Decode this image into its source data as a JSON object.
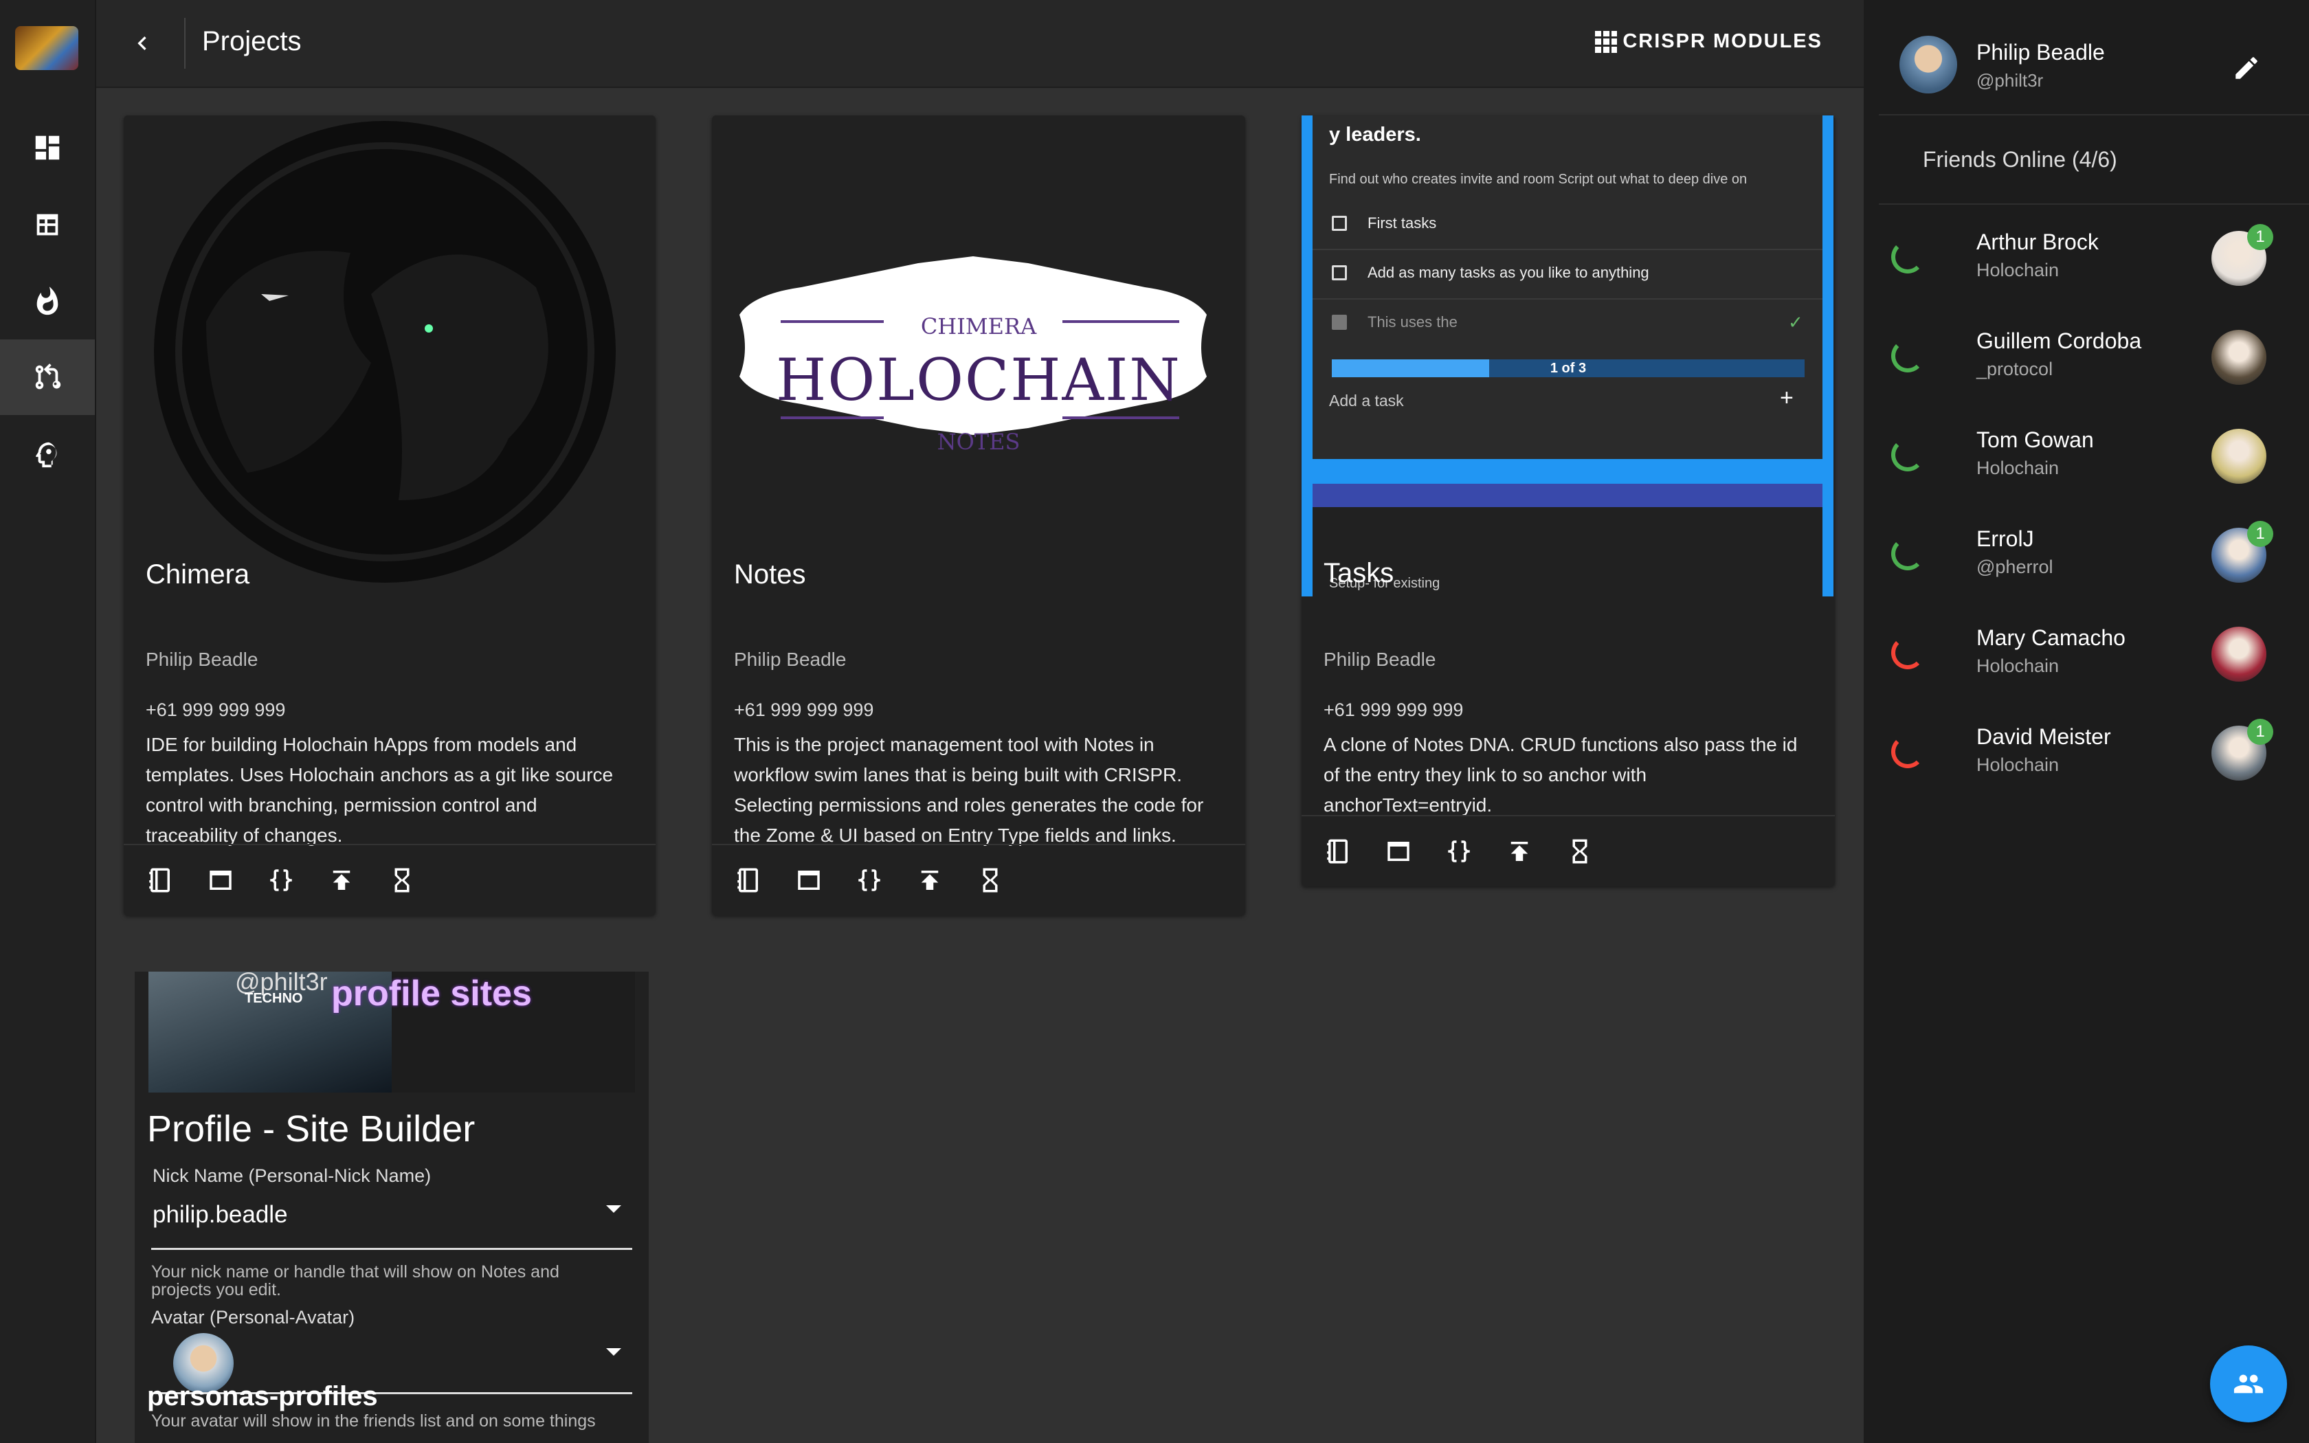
{
  "topbar": {
    "title": "Projects",
    "crispr_label": "CRISPR MODULES"
  },
  "cards": [
    {
      "title": "Chimera",
      "author": "Philip Beadle",
      "phone": "+61 999 999 999",
      "description": "IDE for building Holochain hApps from models and templates. Uses Holochain anchors as a git like source control with branching, permission control and traceability of changes."
    },
    {
      "title": "Notes",
      "author": "Philip Beadle",
      "phone": "+61 999 999 999",
      "description": "This is the project management tool with Notes in workflow swim lanes that is being built with CRISPR. Selecting permissions and roles generates the code for the Zome & UI based on Entry Type fields and links.",
      "logo_top": "CHIMERA",
      "logo_main": "HOLOCHAIN",
      "logo_bottom": "NOTES"
    },
    {
      "title": "Tasks",
      "author": "Philip Beadle",
      "phone": "+61 999 999 999",
      "description": "A clone of Notes DNA. CRUD functions also pass the id of the entry they link to so anchor with anchorText=entryid.",
      "preview": {
        "heading": "y leaders.",
        "subtext": "Find out who creates invite and room Script out what to deep dive on",
        "tasks": [
          "First tasks",
          "Add as many tasks as you like to anything",
          "This uses the"
        ],
        "progress_label": "1 of 3",
        "progress_fraction": 0.333,
        "add_task": "Add a task",
        "setup_text": "Setup- for existing"
      }
    }
  ],
  "profile_card": {
    "banner_handle": "@philt3r",
    "banner_techno": "TECHNO",
    "banner_title": "profile sites",
    "title": "Profile - Site Builder",
    "nick_label": "Nick Name (Personal-Nick Name)",
    "nick_value": "philip.beadle",
    "nick_help": "Your nick name or handle that will show on Notes and projects you edit.",
    "avatar_label": "Avatar (Personal-Avatar)",
    "overlay_text": "personas-profiles",
    "avatar_help": "Your avatar will show in the friends list and on some things"
  },
  "me": {
    "name": "Philip Beadle",
    "handle": "@philt3r"
  },
  "friends_header": "Friends Online (4/6)",
  "friends": [
    {
      "name": "Arthur Brock",
      "sub": "Holochain",
      "status": "#4caf50",
      "badge": "1",
      "avatar": "#e8e2dc"
    },
    {
      "name": "Guillem Cordoba",
      "sub": "_protocol",
      "status": "#4caf50",
      "badge": "",
      "avatar": "#5a4d3c"
    },
    {
      "name": "Tom Gowan",
      "sub": "Holochain",
      "status": "#4caf50",
      "badge": "",
      "avatar": "#cfc07a"
    },
    {
      "name": "ErrolJ",
      "sub": "@pherrol",
      "status": "#4caf50",
      "badge": "1",
      "avatar": "#5578a8"
    },
    {
      "name": "Mary Camacho",
      "sub": "Holochain",
      "status": "#f44336",
      "badge": "",
      "avatar": "#a2283a"
    },
    {
      "name": "David Meister",
      "sub": "Holochain",
      "status": "#f44336",
      "badge": "1",
      "avatar": "#6f7a84"
    }
  ]
}
